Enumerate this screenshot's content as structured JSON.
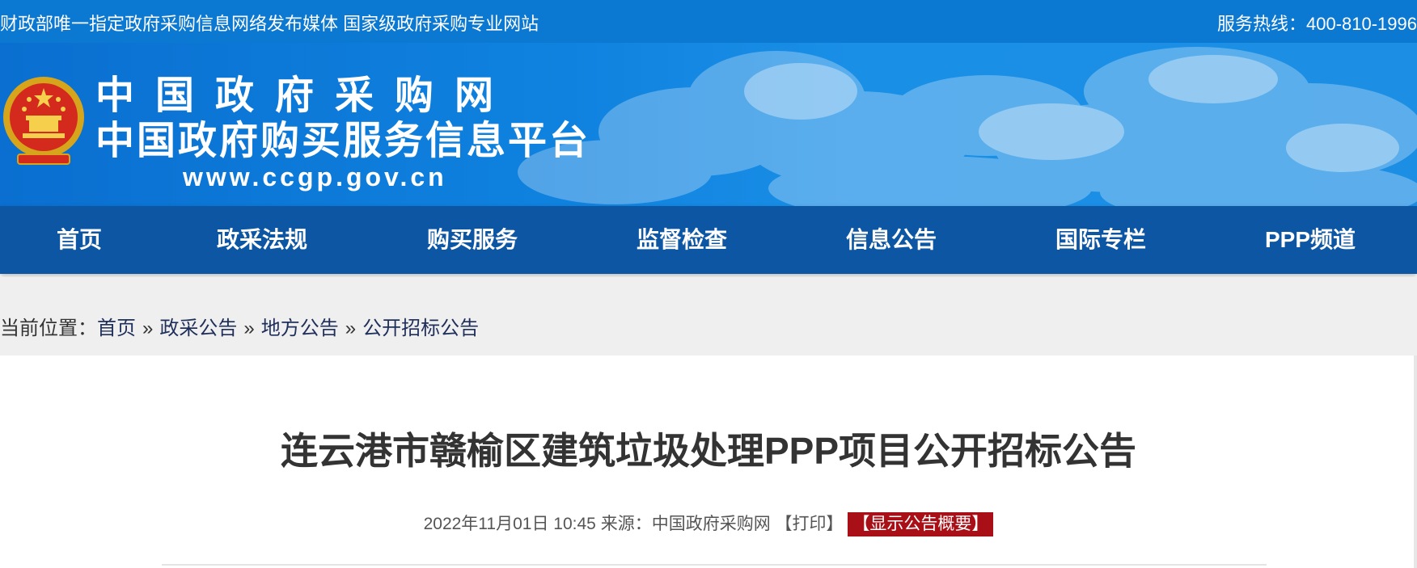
{
  "topbar": {
    "slogan": "财政部唯一指定政府采购信息网络发布媒体 国家级政府采购专业网站",
    "hotline": "服务热线：400-810-1996"
  },
  "logo": {
    "title": "中国政府采购网",
    "subtitle": "中国政府购买服务信息平台",
    "url": "www.ccgp.gov.cn"
  },
  "nav": {
    "items": [
      {
        "label": "首页"
      },
      {
        "label": "政采法规"
      },
      {
        "label": "购买服务"
      },
      {
        "label": "监督检查"
      },
      {
        "label": "信息公告"
      },
      {
        "label": "国际专栏"
      },
      {
        "label": "PPP频道"
      }
    ]
  },
  "breadcrumb": {
    "prefix": "当前位置：",
    "items": [
      "首页",
      "政采公告",
      "地方公告",
      "公开招标公告"
    ],
    "separator": "»"
  },
  "article": {
    "title": "连云港市赣榆区建筑垃圾处理PPP项目公开招标公告",
    "datetime": "2022年11月01日 10:45",
    "source_label": "来源：",
    "source": "中国政府采购网",
    "print_label": "【打印】",
    "summary_label": "【显示公告概要】"
  },
  "colors": {
    "topbar": "#0b78d1",
    "nav": "#0d56a4",
    "crumb_bg": "#efefef",
    "summary_btn": "#a80f16"
  }
}
